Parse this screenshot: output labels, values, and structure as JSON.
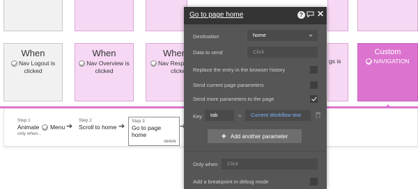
{
  "cards": [
    {
      "when": "When",
      "item": "Nav Logout is clicked"
    },
    {
      "when": "When",
      "item": "Nav Overview is clicked"
    },
    {
      "when": "When",
      "item": "Nav Respon",
      "item2": "clicked"
    },
    {
      "when": "",
      "item": "gs is"
    },
    {
      "when": "Custom",
      "item": "NAVIGATION"
    }
  ],
  "steps": [
    {
      "num": "Step 1",
      "title_pre": "Animate",
      "title_post": "Menu",
      "extra": "only when..."
    },
    {
      "num": "Step 2",
      "title": "Scroll to home"
    },
    {
      "num": "Step 3",
      "title": "Go to page home",
      "extra": "delete"
    }
  ],
  "popup": {
    "title": "Go to page home",
    "destination_label": "Destination",
    "destination_value": "home",
    "data_label": "Data to send",
    "data_placeholder": "Click",
    "replace_label": "Replace the entry in the browser history",
    "send_current_label": "Send current page parameters",
    "send_more_label": "Send more parameters to the page",
    "send_more_checked": true,
    "key_label": "Key",
    "key_value": "tab",
    "eq": "=",
    "param_value": "Current Workflow text",
    "add_param_label": "Add another parameter",
    "only_when_label": "Only when",
    "only_when_placeholder": "Click",
    "breakpoint_label": "Add a breakpoint in debug mode"
  },
  "icons": {
    "help": "help-icon",
    "comment": "comment-icon",
    "close": "close-icon",
    "trash": "trash-icon",
    "plus": "plus-icon",
    "arrow": "arrow-right-icon",
    "check": "check-circle-icon"
  },
  "colors": {
    "accent": "#dc74cf",
    "card_pink": "#f7d8f4",
    "popup_bg": "#565656",
    "popup_header": "#343434",
    "link_blue": "#7fb3ff"
  }
}
